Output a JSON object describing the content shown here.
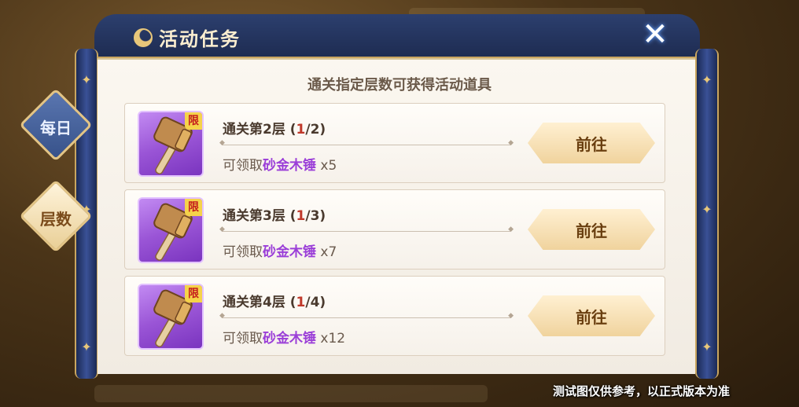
{
  "window": {
    "title": "活动任务",
    "close_label": "✕"
  },
  "header": {
    "subtitle": "通关指定层数可获得活动道具"
  },
  "tabs": [
    {
      "label": "每日",
      "active": false
    },
    {
      "label": "层数",
      "active": true
    }
  ],
  "tasks": [
    {
      "title": "通关第2层",
      "progress_open": "(",
      "progress_current": "1",
      "progress_rest": "/2)",
      "reward_prefix": "可领取",
      "reward_item": "砂金木锤",
      "reward_qty": "x5",
      "badge": "限",
      "button": "前往",
      "icon": "hammer-icon"
    },
    {
      "title": "通关第3层",
      "progress_open": "(",
      "progress_current": "1",
      "progress_rest": "/3)",
      "reward_prefix": "可领取",
      "reward_item": "砂金木锤",
      "reward_qty": "x7",
      "badge": "限",
      "button": "前往",
      "icon": "hammer-icon"
    },
    {
      "title": "通关第4层",
      "progress_open": "(",
      "progress_current": "1",
      "progress_rest": "/4)",
      "reward_prefix": "可领取",
      "reward_item": "砂金木锤",
      "reward_qty": "x12",
      "badge": "限",
      "button": "前往",
      "icon": "hammer-icon"
    }
  ],
  "footer": {
    "disclaimer": "测试图仅供参考，以正式版本为准"
  },
  "colors": {
    "scroll_blue": "#1e2c52",
    "gold_trim": "#c9a660",
    "progress_red": "#c0392b",
    "item_purple": "#9b3fd8"
  }
}
